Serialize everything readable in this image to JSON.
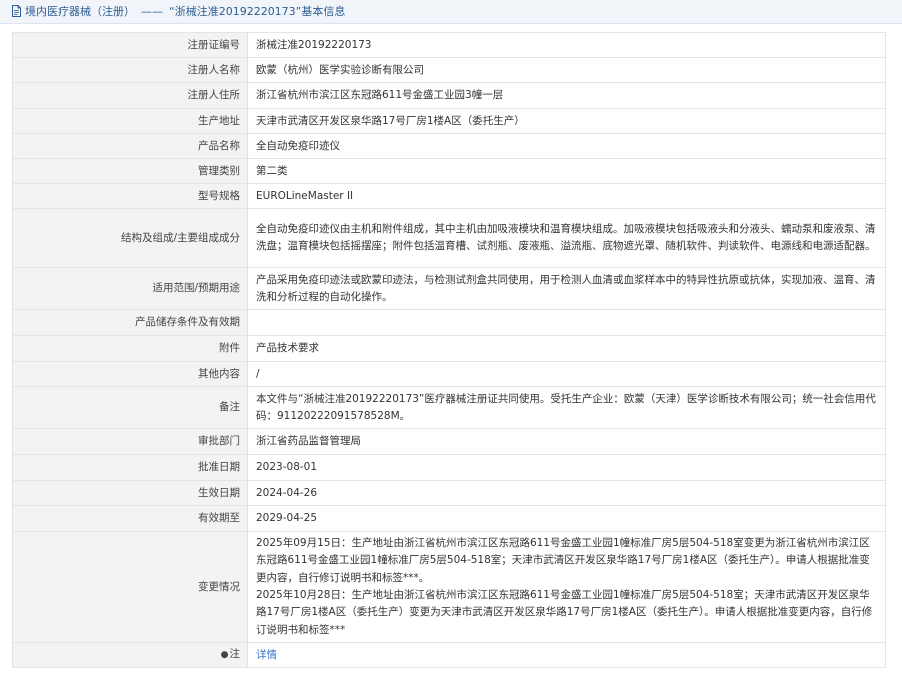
{
  "header": {
    "title": "境内医疗器械（注册）",
    "separator": "——",
    "subtitle": "“浙械注准20192220173”基本信息"
  },
  "rows": [
    {
      "label": "注册证编号",
      "value": "浙械注准20192220173"
    },
    {
      "label": "注册人名称",
      "value": "欧蒙（杭州）医学实验诊断有限公司"
    },
    {
      "label": "注册人住所",
      "value": "浙江省杭州市滨江区东冠路611号金盛工业园3幢一层"
    },
    {
      "label": "生产地址",
      "value": "天津市武清区开发区泉华路17号厂房1楼A区（委托生产）"
    },
    {
      "label": "产品名称",
      "value": "全自动免疫印迹仪"
    },
    {
      "label": "管理类别",
      "value": "第二类"
    },
    {
      "label": "型号规格",
      "value": "EUROLineMaster II"
    },
    {
      "label": "结构及组成/主要组成成分",
      "value": "全自动免疫印迹仪由主机和附件组成，其中主机由加吸液模块和温育模块组成。加吸液模块包括吸液头和分液头、蠕动泵和废液泵、清洗盘；温育模块包括摇摆座；附件包括温育槽、试剂瓶、废液瓶、溢流瓶、底物遮光罩、随机软件、判读软件、电源线和电源适配器。"
    },
    {
      "label": "适用范围/预期用途",
      "value": "产品采用免疫印迹法或欧蒙印迹法，与检测试剂盒共同使用，用于检测人血清或血浆样本中的特异性抗原或抗体，实现加液、温育、清洗和分析过程的自动化操作。"
    },
    {
      "label": "产品储存条件及有效期",
      "value": ""
    },
    {
      "label": "附件",
      "value": "产品技术要求"
    },
    {
      "label": "其他内容",
      "value": "/"
    },
    {
      "label": "备注",
      "value": "本文件与“浙械注准20192220173”医疗器械注册证共同使用。受托生产企业：欧蒙（天津）医学诊断技术有限公司；统一社会信用代码：91120222091578528M。"
    },
    {
      "label": "审批部门",
      "value": "浙江省药品监督管理局"
    },
    {
      "label": "批准日期",
      "value": "2023-08-01"
    },
    {
      "label": "生效日期",
      "value": "2024-04-26"
    },
    {
      "label": "有效期至",
      "value": "2029-04-25"
    }
  ],
  "change": {
    "label": "变更情况",
    "line1": "2025年09月15日：生产地址由浙江省杭州市滨江区东冠路611号金盛工业园1幢标准厂房5层504-518室变更为浙江省杭州市滨江区东冠路611号金盛工业园1幢标准厂房5层504-518室；天津市武清区开发区泉华路17号厂房1楼A区（委托生产）。申请人根据批准变更内容，自行修订说明书和标签***。",
    "line2": "2025年10月28日：生产地址由浙江省杭州市滨江区东冠路611号金盛工业园1幢标准厂房5层504-518室；天津市武清区开发区泉华路17号厂房1楼A区（委托生产）变更为天津市武清区开发区泉华路17号厂房1楼A区（委托生产）。申请人根据批准变更内容，自行修订说明书和标签***"
  },
  "note": {
    "label": "注",
    "link": "详情"
  }
}
